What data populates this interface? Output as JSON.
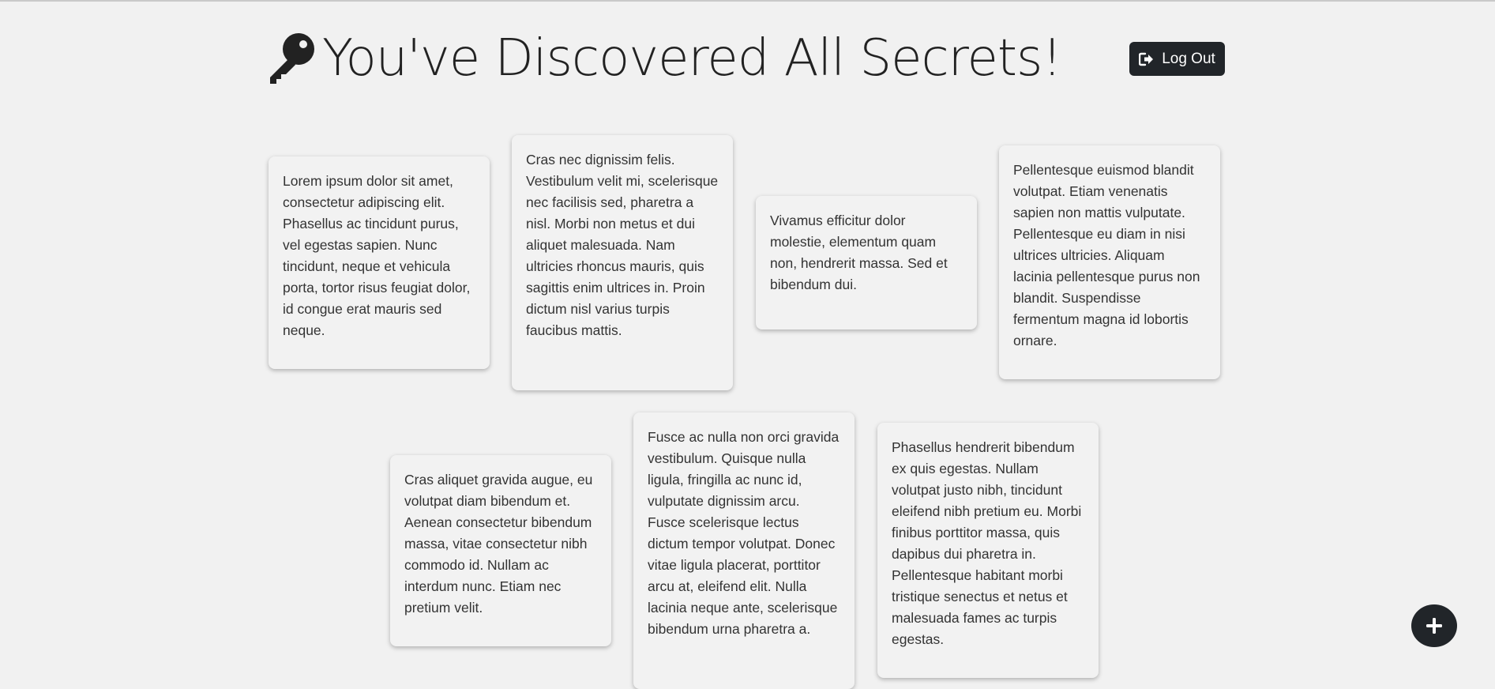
{
  "header": {
    "title": "You've Discovered All Secrets!",
    "icon": "key-icon",
    "logout_label": "Log Out",
    "logout_icon": "sign-out-icon"
  },
  "notes": [
    "Lorem ipsum dolor sit amet, consectetur adipiscing elit. Phasellus ac tincidunt purus, vel egestas sapien. Nunc tincidunt, neque et vehicula porta, tortor risus feugiat dolor, id congue erat mauris sed neque.",
    "Cras nec dignissim felis. Vestibulum velit mi, scelerisque nec facilisis sed, pharetra a nisl. Morbi non metus et dui aliquet malesuada. Nam ultricies rhoncus mauris, quis sagittis enim ultrices in. Proin dictum nisl varius turpis faucibus mattis.",
    "Vivamus efficitur dolor molestie, elementum quam non, hendrerit massa. Sed et bibendum dui.",
    "Pellentesque euismod blandit volutpat. Etiam venenatis sapien non mattis vulputate. Pellentesque eu diam in nisi ultrices ultricies. Aliquam lacinia pellentesque purus non blandit. Suspendisse fermentum magna id lobortis ornare.",
    "Cras aliquet gravida augue, eu volutpat diam bibendum et. Aenean consectetur bibendum massa, vitae consectetur nibh commodo id. Nullam ac interdum nunc. Etiam nec pretium velit.",
    "Fusce ac nulla non orci gravida vestibulum. Quisque nulla ligula, fringilla ac nunc id, vulputate dignissim arcu. Fusce scelerisque lectus dictum tempor volutpat. Donec vitae ligula placerat, porttitor arcu at, eleifend elit. Nulla lacinia neque ante, scelerisque bibendum urna pharetra a.",
    "Phasellus hendrerit bibendum ex quis egestas. Nullam volutpat justo nibh, tincidunt eleifend nibh pretium eu. Morbi finibus porttitor massa, quis dapibus dui pharetra in. Pellentesque habitant morbi tristique senectus et netus et malesuada fames ac turpis egestas."
  ],
  "fab": {
    "icon": "plus-icon"
  },
  "colors": {
    "background": "#f1f1f1",
    "dark": "#212529",
    "card": "#f2f2f2"
  }
}
